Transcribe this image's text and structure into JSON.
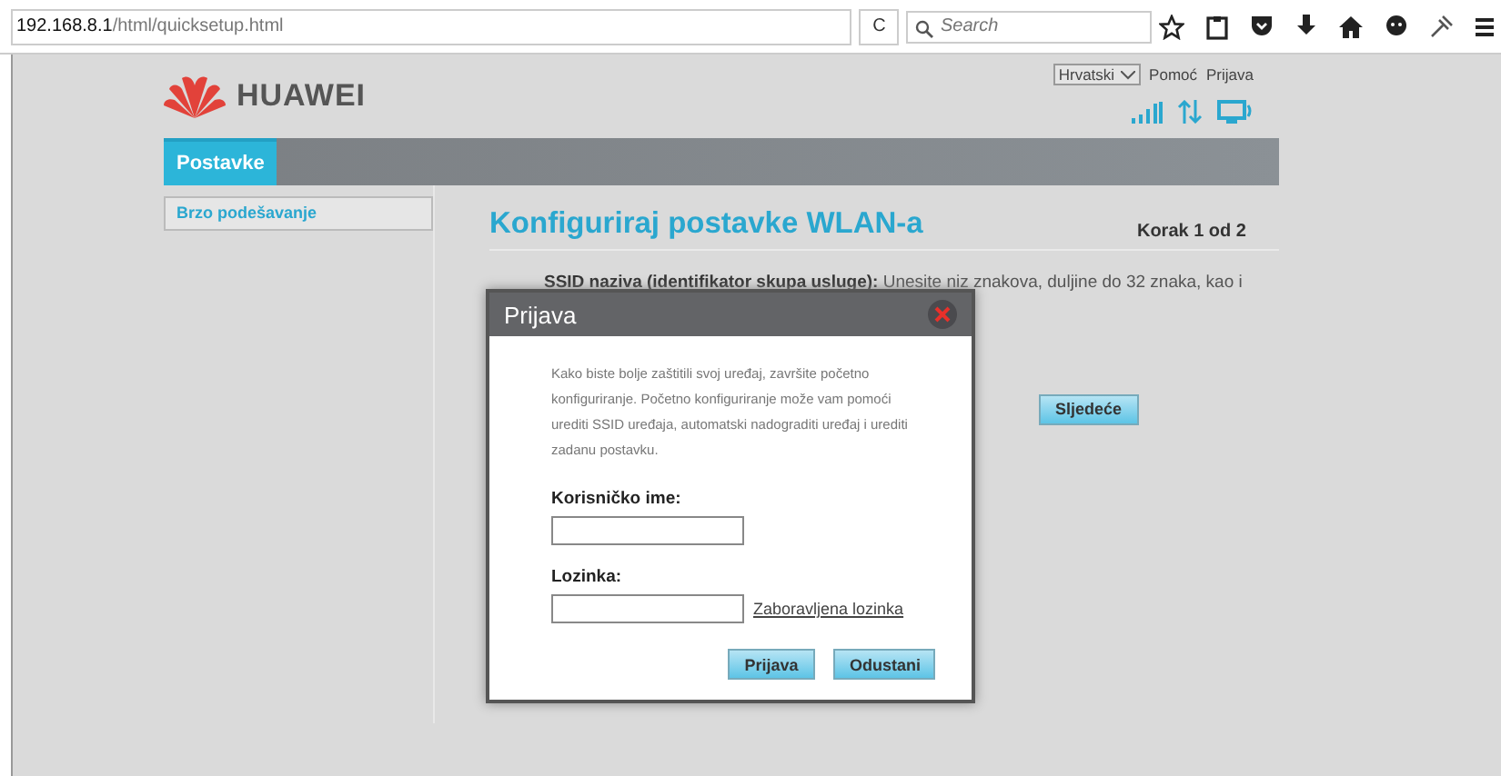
{
  "browser": {
    "url_host": "192.168.8.1",
    "url_path": "/html/quicksetup.html",
    "search": {
      "placeholder": "Search"
    },
    "reload": "C"
  },
  "header": {
    "logo": "HUAWEI",
    "language": "Hrvatski",
    "links": [
      "Pomoć",
      "Prijava"
    ]
  },
  "nav": {
    "tabs": [
      {
        "label": "Postavke",
        "selected": true
      }
    ]
  },
  "sidebar": {
    "items": [
      {
        "label": "Brzo podešavanje",
        "selected": true
      }
    ]
  },
  "main": {
    "title": "Konfiguriraj postavke WLAN-a",
    "step": "Korak 1 od 2",
    "ssid_text": "**SSID naziva (identifikator skupa usluge):** Unesite niz znakova, duljine do 32 znaka, kao i",
    "next_button": "Sljedeće"
  },
  "dialog": {
    "title": "Prijava",
    "message": "Kako biste bolje zaštitili svoj uređaj, završite početno konfiguriranje. Početno konfiguriranje može vam pomoći urediti SSID uređaja, automatski nadograditi uređaj i urediti zadanu postavku.",
    "username_label": "Korisničko ime:",
    "password_label": "Lozinka:",
    "forgot_link": "Zaboravljena lozinka",
    "buttons": [
      "Prijava",
      "Odustani"
    ]
  }
}
